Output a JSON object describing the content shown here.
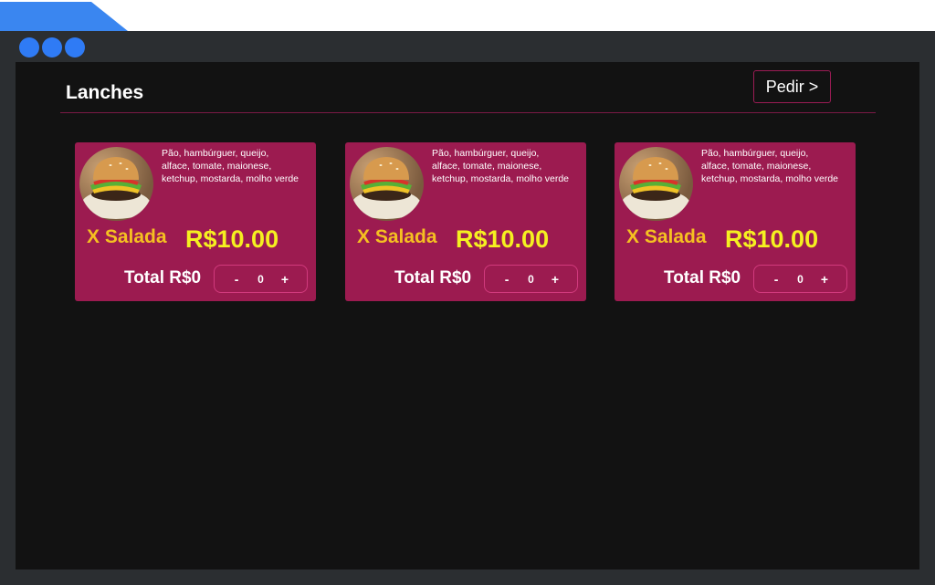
{
  "app": {
    "title": "Lanches",
    "order_button": "Pedir >"
  },
  "products": [
    {
      "description": "Pão, hambúrguer, queijo, alface, tomate, maionese, ketchup, mostarda, molho verde",
      "name": "X Salada",
      "price": "R$10.00",
      "total": "Total R$0",
      "quantity": "0",
      "minus": "-",
      "plus": "+"
    },
    {
      "description": "Pão, hambúrguer, queijo, alface, tomate, maionese, ketchup, mostarda, molho verde",
      "name": "X Salada",
      "price": "R$10.00",
      "total": "Total R$0",
      "quantity": "0",
      "minus": "-",
      "plus": "+"
    },
    {
      "description": "Pão, hambúrguer, queijo, alface, tomate, maionese, ketchup, mostarda, molho verde",
      "name": "X Salada",
      "price": "R$10.00",
      "total": "Total R$0",
      "quantity": "0",
      "minus": "-",
      "plus": "+"
    }
  ],
  "colors": {
    "tab_accent": "#3a86f0",
    "window_dots": "#2f7bf5",
    "card_background": "#9c1b50",
    "product_name": "#f5c021",
    "price": "#f5f020",
    "divider": "#7b1a46"
  }
}
